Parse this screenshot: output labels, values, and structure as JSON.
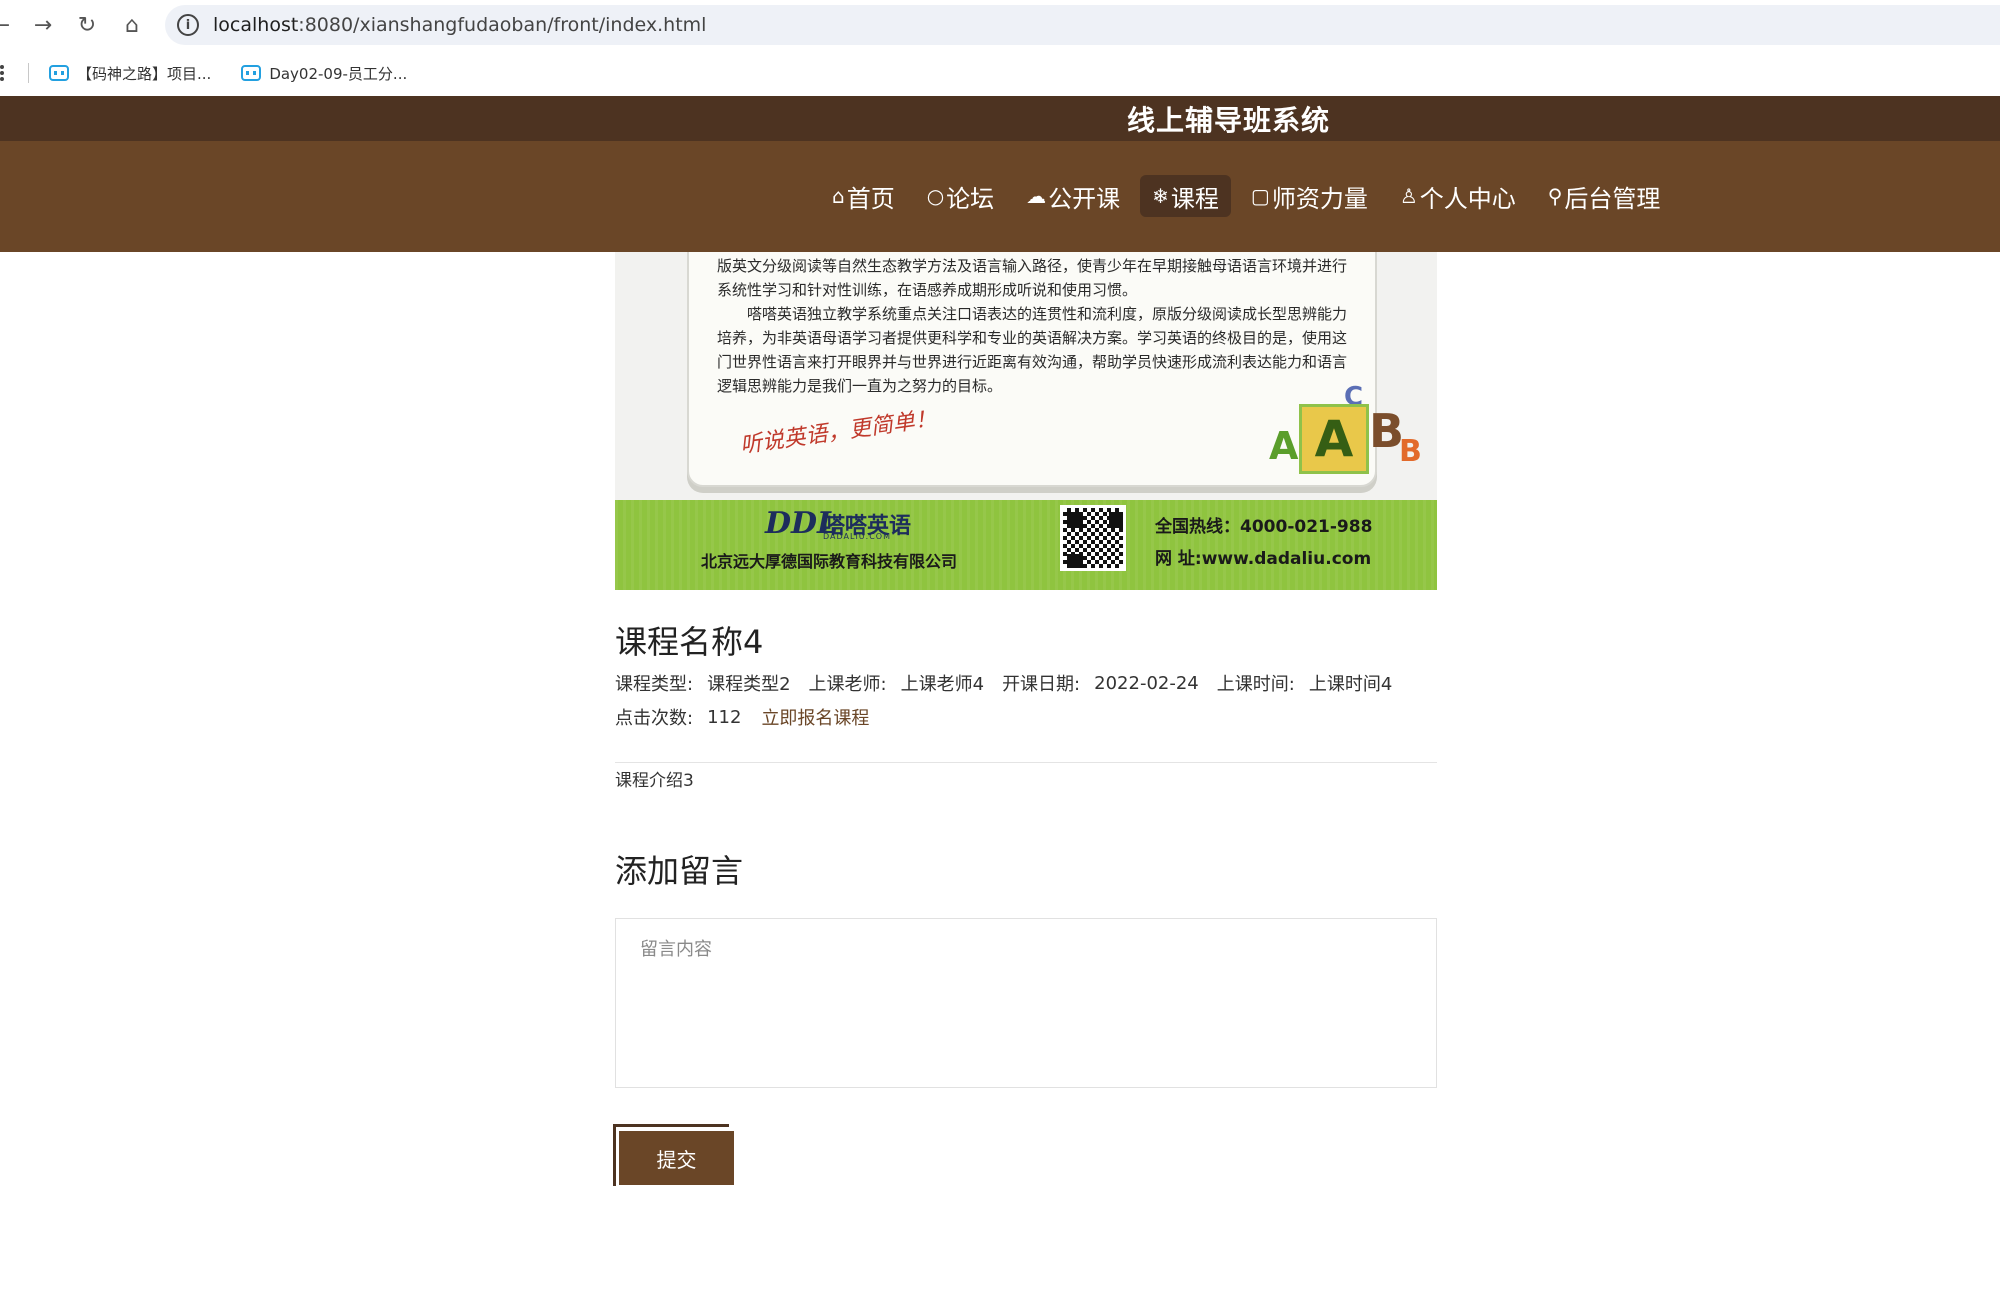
{
  "browser": {
    "url_host": "localhost",
    "url_rest": ":8080/xianshangfudaoban/front/index.html",
    "bookmarks": [
      {
        "label": "【码神之路】项目..."
      },
      {
        "label": "Day02-09-员工分..."
      }
    ],
    "icons": {
      "back": "arrow-left-icon",
      "forward": "arrow-right-icon",
      "reload": "reload-icon",
      "home": "home-icon",
      "info": "info-icon"
    }
  },
  "site": {
    "title": "线上辅导班系统",
    "colors": {
      "header_dark": "#4d3321",
      "header": "#6a4627",
      "accent": "#6a4627"
    },
    "menu": [
      {
        "icon": "⌂",
        "label": "首页"
      },
      {
        "icon": "○",
        "label": "论坛"
      },
      {
        "icon": "☁",
        "label": "公开课"
      },
      {
        "icon": "❄",
        "label": "课程",
        "active": true
      },
      {
        "icon": "▢",
        "label": "师资力量"
      },
      {
        "icon": "♙",
        "label": "个人中心"
      },
      {
        "icon": "⚲",
        "label": "后台管理"
      }
    ]
  },
  "banner": {
    "paragraph1": "版英文分级阅读等自然生态教学方法及语言输入路径，使青少年在早期接触母语语言环境并进行系统性学习和针对性训练，在语感养成期形成听说和使用习惯。",
    "paragraph2": "嗒嗒英语独立教学系统重点关注口语表达的连贯性和流利度，原版分级阅读成长型思辨能力培养，为非英语母语学习者提供更科学和专业的英语解决方案。学习英语的终极目的是，使用这门世界性语言来打开眼界并与世界进行近距离有效沟通，帮助学员快速形成流利表达能力和语言逻辑思辨能力是我们一直为之努力的目标。",
    "slogan": "听说英语，更简单！",
    "logo_letters": "DDL",
    "brand": "嗒嗒英语",
    "brand_sub": "DADALIU.COM",
    "company": "北京远大厚德国际教育科技有限公司",
    "hotline": "全国热线：4000-021-988",
    "website": "网  址:www.dadaliu.com"
  },
  "course": {
    "name": "课程名称4",
    "type_label": "课程类型:",
    "type_value": "课程类型2",
    "teacher_label": "上课老师:",
    "teacher_value": "上课老师4",
    "start_label": "开课日期:",
    "start_value": "2022-02-24",
    "time_label": "上课时间:",
    "time_value": "上课时间4",
    "clicks_label": "点击次数:",
    "clicks_value": "112",
    "signup_label": "立即报名课程",
    "intro": "课程介绍3"
  },
  "comment": {
    "title": "添加留言",
    "placeholder": "留言内容",
    "submit_label": "提交"
  }
}
